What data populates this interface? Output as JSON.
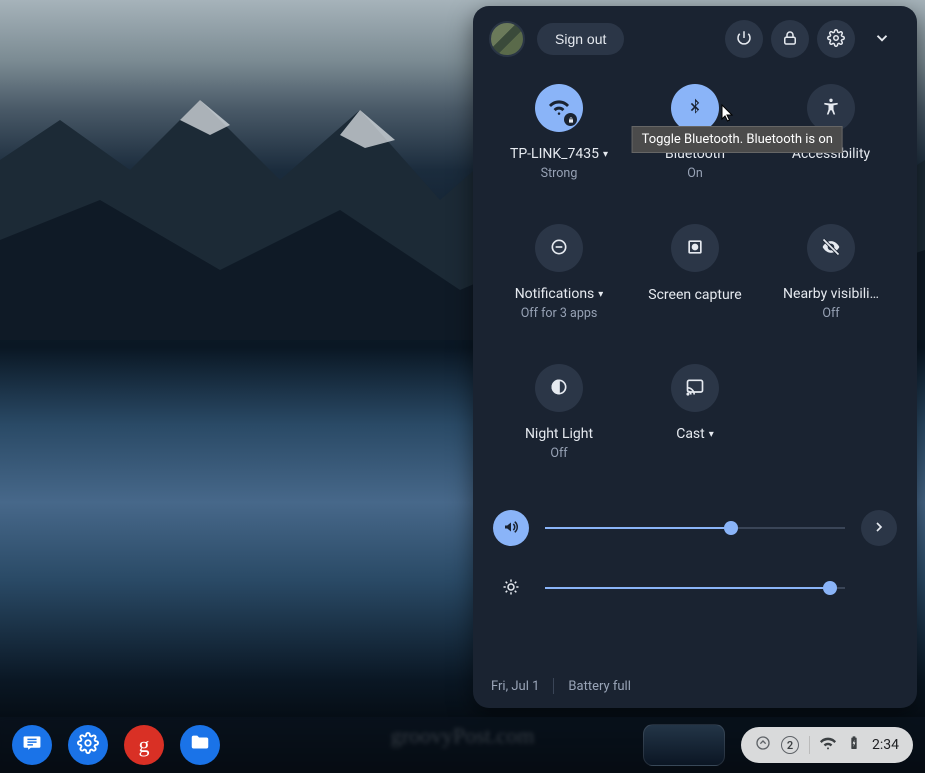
{
  "header": {
    "sign_out": "Sign out"
  },
  "tiles": {
    "wifi": {
      "label": "TP-LINK_7435",
      "sub": "Strong",
      "has_caret": true
    },
    "bt": {
      "label": "Bluetooth",
      "sub": "On",
      "tooltip": "Toggle Bluetooth. Bluetooth is on"
    },
    "a11y": {
      "label": "Accessibility",
      "sub": ""
    },
    "notif": {
      "label": "Notifications",
      "sub": "Off for 3 apps",
      "has_caret": true
    },
    "capture": {
      "label": "Screen capture",
      "sub": ""
    },
    "nearby": {
      "label": "Nearby visibili…",
      "sub": "Off"
    },
    "night": {
      "label": "Night Light",
      "sub": "Off"
    },
    "cast": {
      "label": "Cast",
      "sub": "",
      "has_caret": true
    }
  },
  "sliders": {
    "volume": 62,
    "brightness": 95
  },
  "footer": {
    "date": "Fri, Jul 1",
    "battery": "Battery full"
  },
  "shelf": {
    "g_label": "g",
    "notif_count": "2",
    "clock": "2:34"
  },
  "watermark": "groovyPost.com"
}
